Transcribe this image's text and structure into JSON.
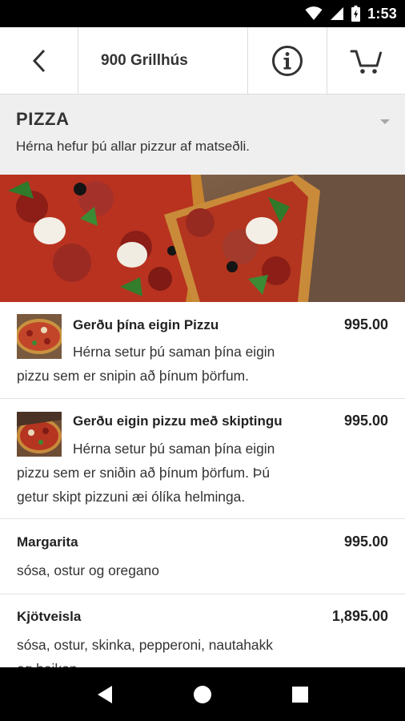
{
  "status_bar": {
    "time": "1:53"
  },
  "header": {
    "title": "900 Grillhús"
  },
  "category": {
    "title": "PIZZA",
    "description": "Hérna hefur þú allar pizzur af matseðli."
  },
  "menu_items": [
    {
      "name": "Gerðu þína eigin Pizzu",
      "price": "995.00",
      "desc_lines": [
        "Hérna setur þú saman þína eigin",
        "pizzu sem er snipin að þínum þörfum."
      ]
    },
    {
      "name": "Gerðu eigin pizzu með skiptingu",
      "price": "995.00",
      "desc_lines": [
        "Hérna setur þú saman þína eigin",
        "pizzu sem er sniðin að þínum þörfum. Þú",
        "getur skipt pizzuni æi ólíka helminga."
      ]
    },
    {
      "name": "Margarita",
      "price": "995.00",
      "desc_lines": [
        "sósa, ostur og oregano"
      ]
    },
    {
      "name": "Kjötveisla",
      "price": "1,895.00",
      "desc_lines": [
        "sósa, ostur, skinka, pepperoni, nautahakk",
        "og beikon"
      ]
    }
  ],
  "colors": {
    "accent_red": "#b42a20",
    "background_grey": "#efefef"
  }
}
